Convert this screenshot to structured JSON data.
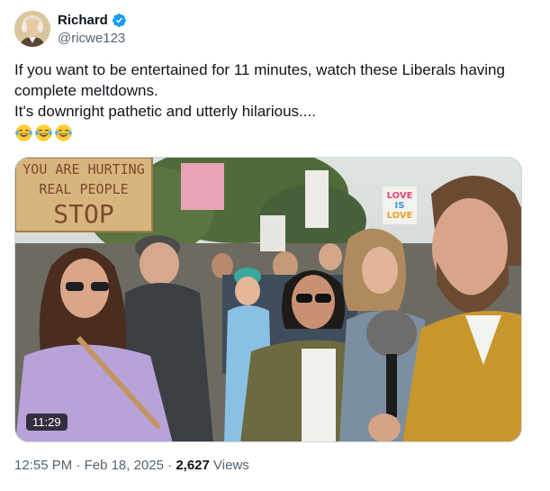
{
  "author": {
    "display_name": "Richard",
    "handle": "@ricwe123",
    "verified": true,
    "verified_color": "#1d9bf0"
  },
  "tweet": {
    "line1": "If you want to be entertained for 11 minutes, watch these Liberals having",
    "line2": "complete meltdowns.",
    "line3": "It's downright pathetic and utterly hilarious....",
    "emojis": [
      "face-with-tears-of-joy",
      "face-with-tears-of-joy",
      "face-with-tears-of-joy"
    ]
  },
  "media": {
    "type": "video",
    "duration": "11:29",
    "sign_left": [
      "YOU ARE HURTING",
      "REAL PEOPLE",
      "STOP"
    ],
    "sign_right": [
      "LOVE",
      "IS",
      "LOVE"
    ]
  },
  "meta": {
    "time": "12:55 PM",
    "separator": "·",
    "date": "Feb 18, 2025",
    "views_count": "2,627",
    "views_label": "Views"
  }
}
